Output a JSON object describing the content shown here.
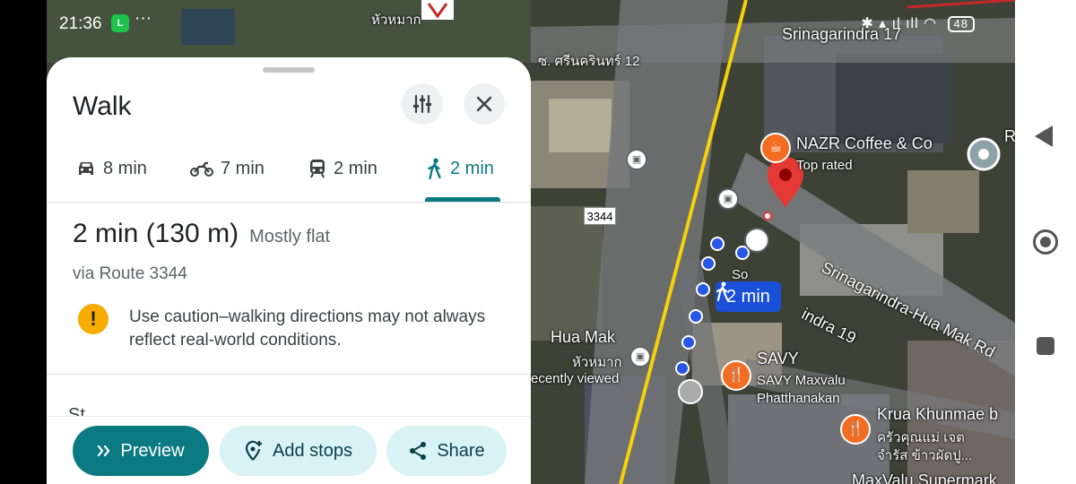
{
  "status_bar": {
    "time": "21:36",
    "messenger_icon": "line-chat-icon",
    "more": "···",
    "system_indicators": "✱ ▴ ıl ıll",
    "battery": "48"
  },
  "map": {
    "labels": {
      "top_thai_road": "ซ. ศรีนครินทร์ 12",
      "srinagarindra_17": "Srinagarindra 17",
      "hua_mak_top": "หัวหมาก",
      "nazr_name": "NAZR Coffee & Co",
      "nazr_sub": "Top rated",
      "srinagarindra_hua_mak_rd": "Srinagarindra-Hua Mak Rd",
      "indra_19": "indra 19",
      "route_number": "3344",
      "hua_mak_en": "Hua Mak",
      "hua_mak_th": "หัวหมาก",
      "recently_viewed": "ecently viewed",
      "savy_name": "SAVY",
      "savy_sub1": "SAVY Maxvalu",
      "savy_sub2": "Phatthanakan",
      "krua_name": "Krua Khunmae b",
      "krua_th1": "ครัวคุณแม่ เจต",
      "krua_th2": "จำรัส ข้าวผัดปู...",
      "maxvalu_partial": "MaxValu Supermark",
      "right_edge": "R",
      "so_partial": "So"
    },
    "route_chip_label": "2 min",
    "colors": {
      "route_blue": "#1a50d8",
      "pin_red": "#e53935",
      "poi_orange": "#f26c21",
      "major_road_yellow": "#f5d10a"
    }
  },
  "sheet": {
    "title": "Walk",
    "filter_icon": "sliders-icon",
    "close_icon": "close-icon",
    "modes": [
      {
        "icon": "car-icon",
        "label": "8 min",
        "active": false
      },
      {
        "icon": "motorcycle-icon",
        "label": "7 min",
        "active": false
      },
      {
        "icon": "train-icon",
        "label": "2 min",
        "active": false
      },
      {
        "icon": "walk-icon",
        "label": "2 min",
        "active": true
      }
    ],
    "summary": {
      "duration": "2 min (130 m)",
      "terrain": "Mostly flat"
    },
    "via": "via Route 3344",
    "warning": {
      "icon": "!",
      "text": "Use caution–walking directions may not always reflect real-world conditions."
    },
    "steps_peek": "St",
    "actions": {
      "preview": "Preview",
      "add_stops": "Add stops",
      "share": "Share"
    },
    "accent_color": "#0b7a83"
  },
  "nav_bar": {
    "back": "back-icon",
    "home": "home-icon",
    "recents": "recents-icon"
  }
}
